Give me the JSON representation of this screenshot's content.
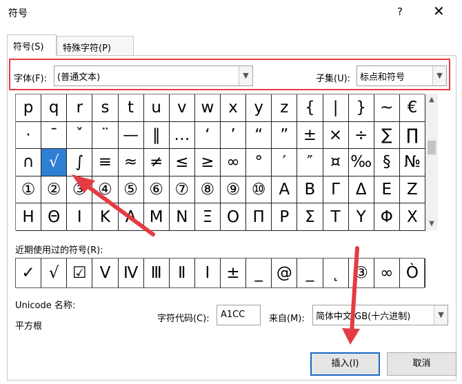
{
  "window": {
    "title": "符号",
    "help": "?",
    "close": "✕"
  },
  "tabs": [
    {
      "label": "符号(S)"
    },
    {
      "label": "特殊字符(P)"
    }
  ],
  "font": {
    "label": "字体(F):",
    "value": "(普通文本)"
  },
  "subset": {
    "label": "子集(U):",
    "value": "标点和符号"
  },
  "symbols": [
    [
      "p",
      "q",
      "r",
      "s",
      "t",
      "u",
      "v",
      "w",
      "x",
      "y",
      "z",
      "{",
      "|",
      "}",
      "~",
      "€"
    ],
    [
      "·",
      "ˉ",
      "ˇ",
      "¨",
      "—",
      "‖",
      "…",
      "‘",
      "’",
      "“",
      "”",
      "±",
      "×",
      "÷",
      "∑",
      "∏"
    ],
    [
      "∩",
      "√",
      "∫",
      "≡",
      "≈",
      "≠",
      "≤",
      "≥",
      "∞",
      "°",
      "′",
      "″",
      "¤",
      "‰",
      "§",
      "№"
    ],
    [
      "①",
      "②",
      "③",
      "④",
      "⑤",
      "⑥",
      "⑦",
      "⑧",
      "⑨",
      "⑩",
      "Α",
      "Β",
      "Γ",
      "Δ",
      "Ε",
      "Ζ"
    ],
    [
      "Η",
      "Θ",
      "Ι",
      "Κ",
      "Λ",
      "Μ",
      "Ν",
      "Ξ",
      "Ο",
      "Π",
      "Ρ",
      "Σ",
      "Τ",
      "Υ",
      "Φ",
      "Χ"
    ]
  ],
  "selected_symbol": "√",
  "recent": {
    "label": "近期使用过的符号(R):",
    "symbols": [
      "✓",
      "√",
      "☑",
      "Ⅴ",
      "Ⅳ",
      "Ⅲ",
      "Ⅱ",
      "Ⅰ",
      "±",
      "_",
      "@",
      "_",
      "˛",
      "③",
      "∞",
      "Ò"
    ]
  },
  "unicode": {
    "label": "Unicode 名称:",
    "value": "平方根"
  },
  "char_code": {
    "label": "字符代码(C):",
    "value": "A1CC"
  },
  "from": {
    "label": "来自(M):",
    "value": "简体中文 GB(十六进制)"
  },
  "buttons": {
    "insert": "插入(I)",
    "cancel": "取消"
  },
  "colors": {
    "accent": "#2f7fd5",
    "highlight": "#e33c42"
  },
  "icons": {
    "help": "question-icon",
    "close": "close-icon",
    "dropdown": "chevron-down-icon"
  }
}
